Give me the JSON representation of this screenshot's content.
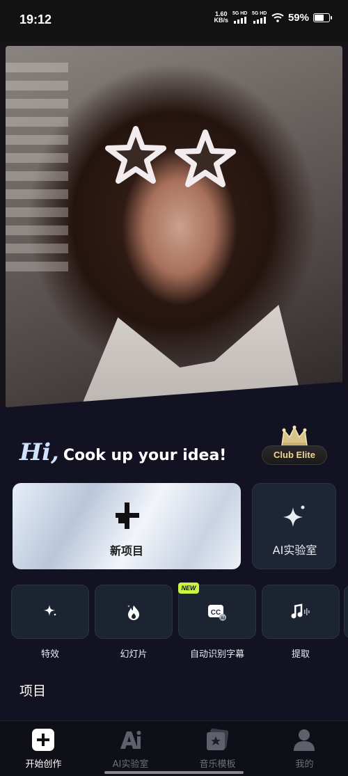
{
  "status_bar": {
    "time": "19:12",
    "net_speed_value": "1.60",
    "net_speed_unit": "KB/s",
    "signal_1": "5G HD",
    "signal_2": "5G HD",
    "battery": "59%"
  },
  "hero": {
    "image": "portrait-woman-star-sunglasses"
  },
  "greeting": {
    "hi": "Hi,",
    "text": "Cook up your idea!"
  },
  "club": {
    "label": "Club Elite",
    "icon": "crown-icon"
  },
  "main_actions": {
    "new_project": "新项目",
    "ai_lab": "AI实验室"
  },
  "tools": [
    {
      "label": "特效",
      "icon": "sparkle-icon",
      "badge": ""
    },
    {
      "label": "幻灯片",
      "icon": "flame-icon",
      "badge": ""
    },
    {
      "label": "自动识别字幕",
      "icon": "cc-icon",
      "badge": "NEW"
    },
    {
      "label": "提取",
      "icon": "music-extract-icon",
      "badge": ""
    }
  ],
  "section": {
    "projects_title": "项目"
  },
  "bottom_nav": [
    {
      "label": "开始创作",
      "icon": "plus-square-icon",
      "active": true
    },
    {
      "label": "AI实验室",
      "icon": "ai-icon",
      "active": false
    },
    {
      "label": "音乐模板",
      "icon": "music-template-icon",
      "active": false
    },
    {
      "label": "我的",
      "icon": "user-icon",
      "active": false
    }
  ],
  "colors": {
    "background": "#121222",
    "accent_badge": "#c9f542",
    "club_text": "#f3d68a"
  }
}
